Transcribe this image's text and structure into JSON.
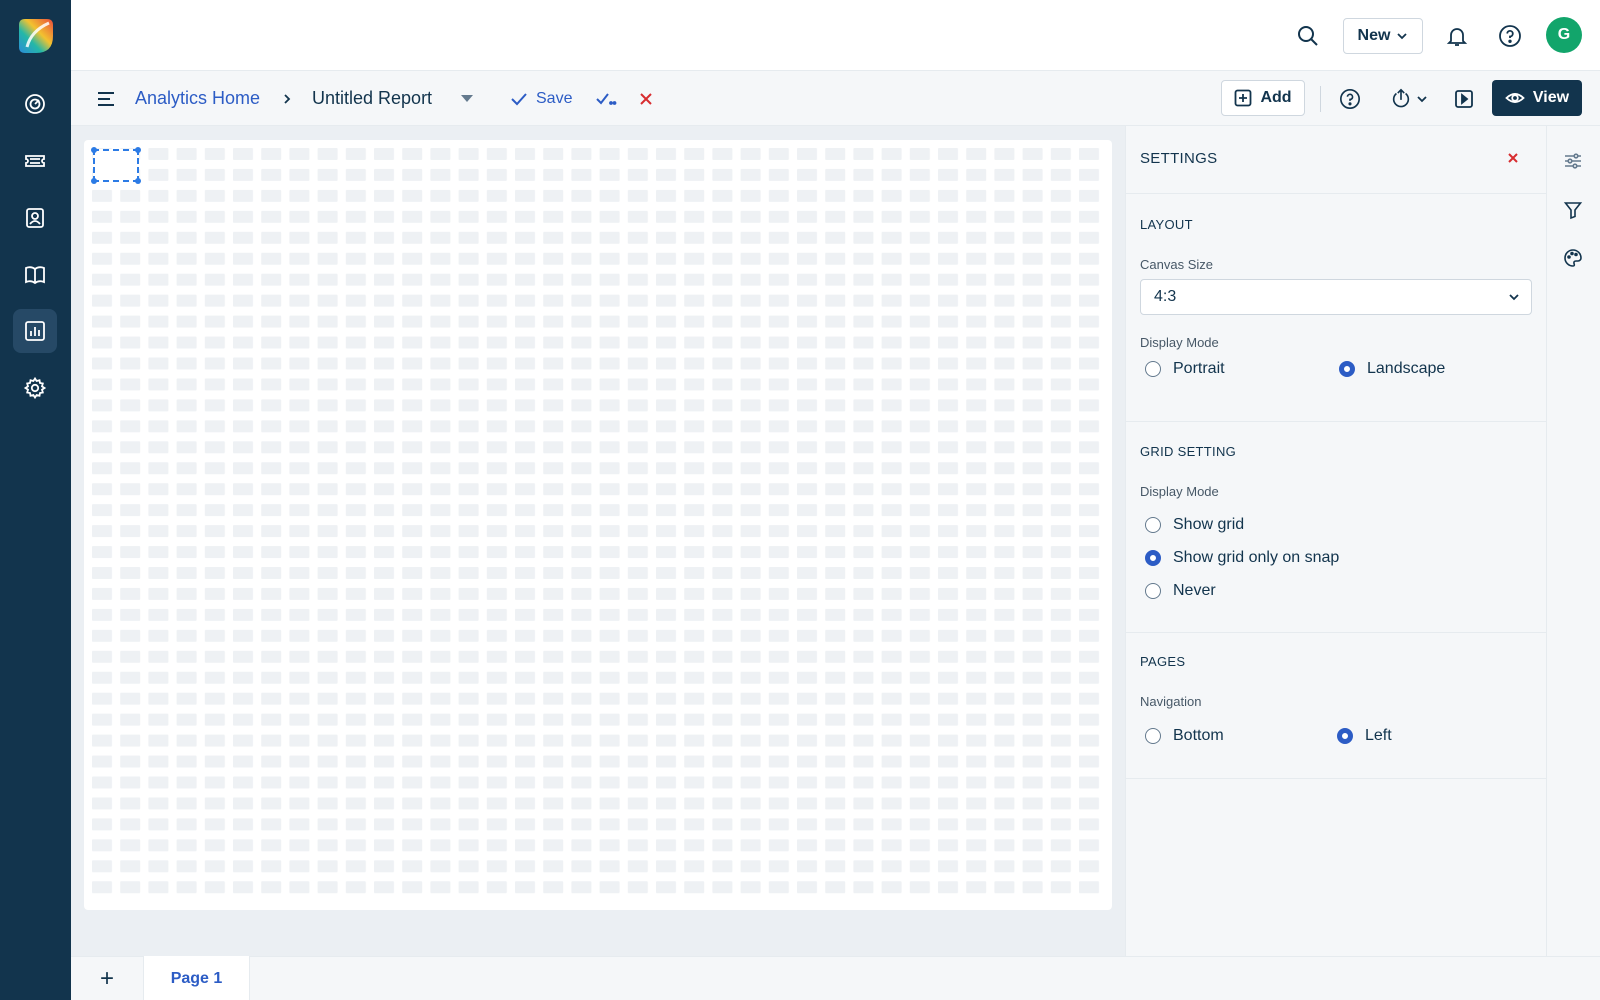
{
  "topbar": {
    "new_label": "New",
    "avatar_initial": "G"
  },
  "subbar": {
    "breadcrumb_home": "Analytics Home",
    "report_title": "Untitled Report",
    "save_label": "Save",
    "add_label": "Add",
    "view_label": "View"
  },
  "settings": {
    "title": "SETTINGS",
    "layout": {
      "title": "LAYOUT",
      "canvas_size_label": "Canvas Size",
      "canvas_size_value": "4:3",
      "display_mode_label": "Display Mode",
      "options": [
        "Portrait",
        "Landscape"
      ],
      "selected": "Landscape"
    },
    "grid": {
      "title": "GRID SETTING",
      "display_mode_label": "Display Mode",
      "options": [
        "Show grid",
        "Show grid only on snap",
        "Never"
      ],
      "selected": "Show grid only on snap"
    },
    "pages": {
      "title": "PAGES",
      "navigation_label": "Navigation",
      "options": [
        "Bottom",
        "Left"
      ],
      "selected": "Left"
    }
  },
  "pagebar": {
    "add_symbol": "+",
    "tabs": [
      "Page 1"
    ]
  },
  "colors": {
    "rail": "#12344d",
    "accent": "#2c5cc5",
    "danger": "#d72d30",
    "avatar": "#12a56b"
  },
  "icons": {
    "rail": [
      "logo",
      "dashboard-icon",
      "ticket-icon",
      "contacts-icon",
      "knowledge-base-icon",
      "analytics-icon",
      "settings-gear-icon"
    ],
    "topbar": [
      "search-icon",
      "bell-icon",
      "help-icon"
    ],
    "right_rail": [
      "sliders-icon",
      "filter-icon",
      "palette-icon"
    ]
  }
}
